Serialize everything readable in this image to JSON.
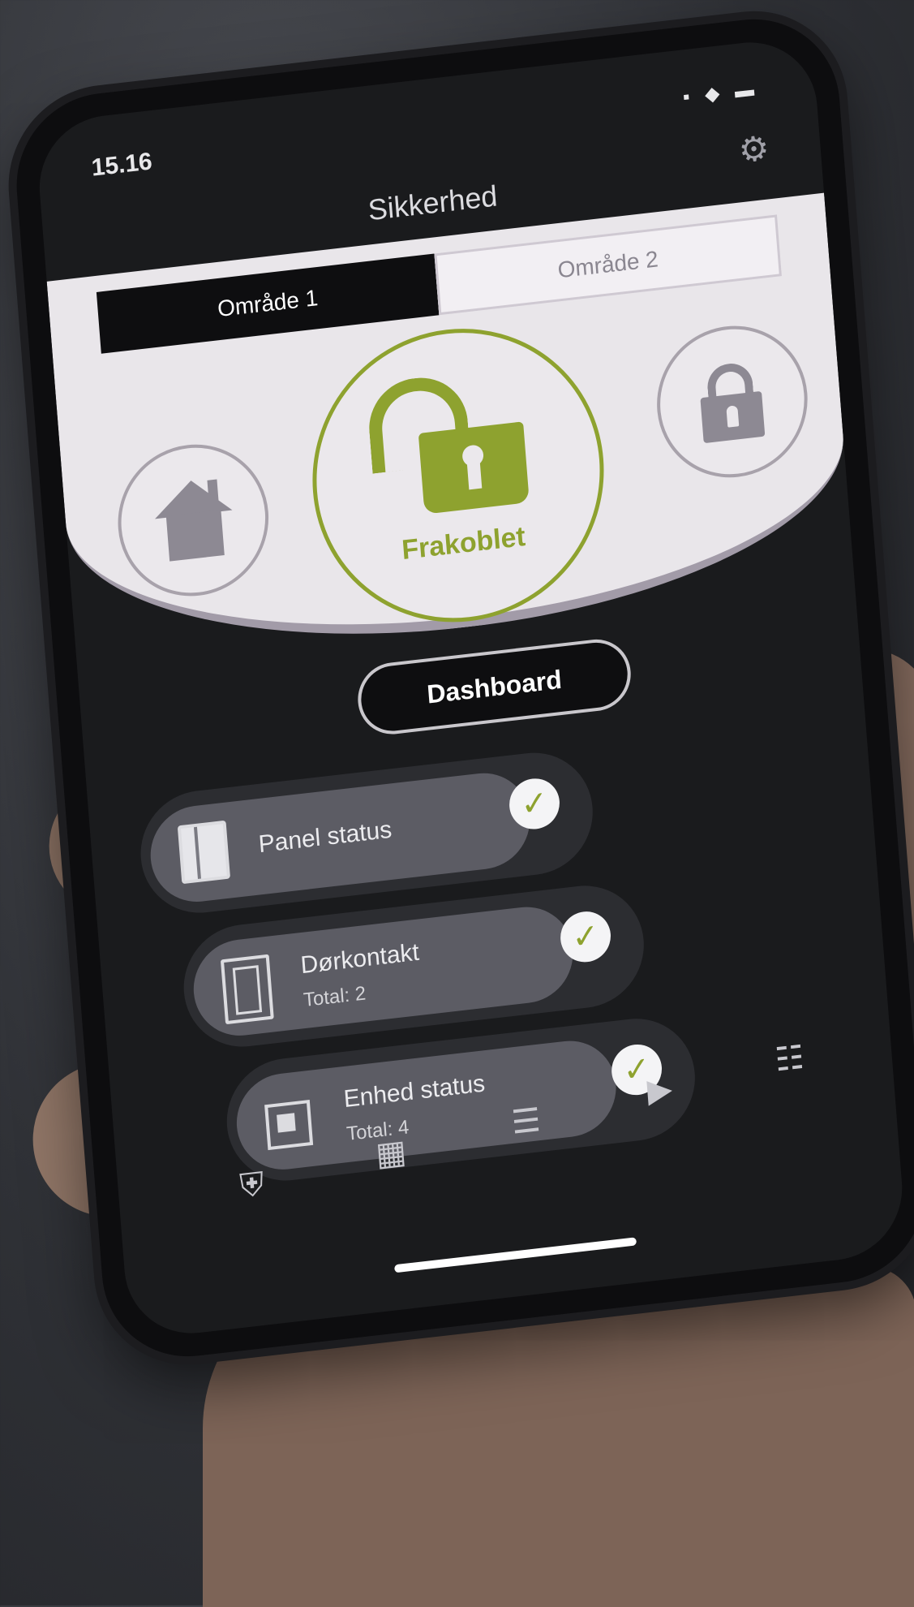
{
  "status_bar": {
    "time": "15.16",
    "icons": "▪ ◆ ▬"
  },
  "header": {
    "title": "Sikkerhed"
  },
  "areas": {
    "tabs": [
      {
        "label": "Område 1"
      },
      {
        "label": "Område 2"
      }
    ]
  },
  "arm_state": {
    "status_label": "Frakoblet"
  },
  "dashboard": {
    "label": "Dashboard"
  },
  "cards": [
    {
      "title": "Panel status",
      "subtitle": ""
    },
    {
      "title": "Dørkontakt",
      "subtitle": "Total: 2"
    },
    {
      "title": "Enhed status",
      "subtitle": "Total: 4"
    }
  ],
  "tabbar": {
    "icons": [
      "shield-icon",
      "chip-icon",
      "sliders-icon",
      "camera-icon",
      "list-icon"
    ],
    "glyphs": {
      "shield": "⛨",
      "chip": "▦",
      "sliders": "☰",
      "camera": "▶",
      "list": "☷"
    }
  },
  "colors": {
    "accent": "#8ea22f",
    "hero_bg": "#e9e6ea",
    "card_bg": "#5c5c64"
  }
}
